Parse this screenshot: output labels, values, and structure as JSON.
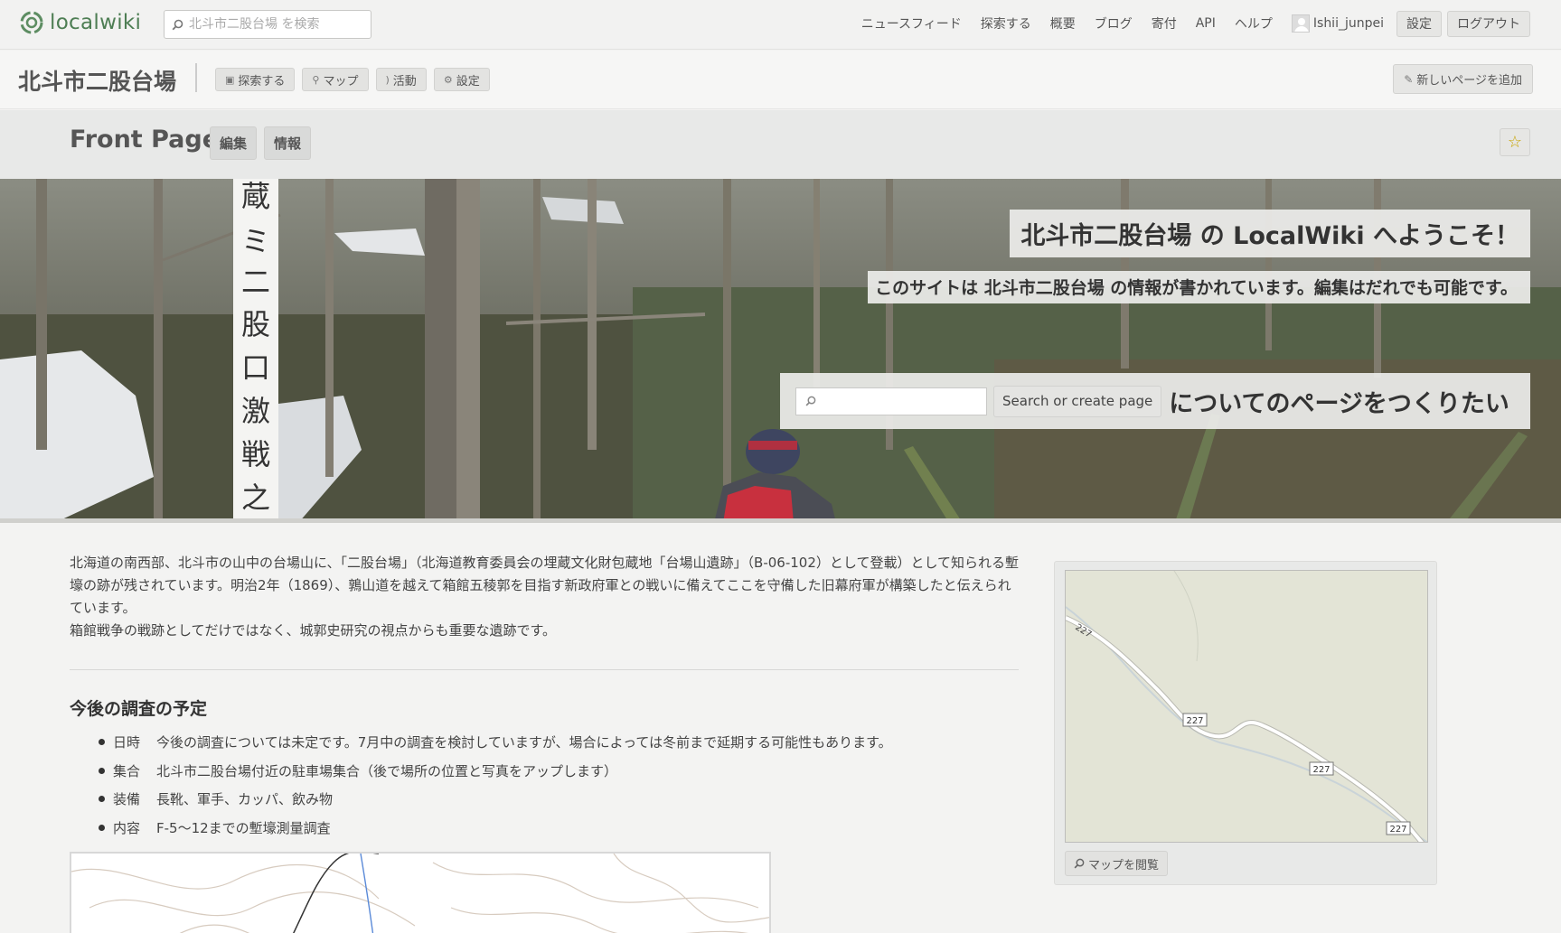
{
  "brand": {
    "name": "localwiki"
  },
  "top_search": {
    "placeholder": "北斗市二股台場 を検索"
  },
  "topnav": {
    "links": [
      "ニュースフィード",
      "探索する",
      "概要",
      "ブログ",
      "寄付",
      "API",
      "ヘルプ"
    ],
    "username": "Ishii_junpei",
    "settings_label": "設定",
    "logout_label": "ログアウト"
  },
  "region": {
    "title": "北斗市二股台場",
    "explore_label": "探索する",
    "map_label": "マップ",
    "activity_label": "活動",
    "settings_label": "設定",
    "new_page_label": "新しいページを追加"
  },
  "page": {
    "title": "Front Page",
    "edit_tab": "編集",
    "info_tab": "情報"
  },
  "hero": {
    "welcome": "北斗市二股台場 の LocalWiki へようこそ！",
    "subtitle": "このサイトは 北斗市二股台場 の情報が書かれています。編集はだれでも可能です。",
    "create_button": "Search or create page",
    "create_suffix": "についてのページをつくりたい",
    "signpost_text": "蔵ミ二股口激戦之地"
  },
  "intro": {
    "paragraph1": "北海道の南西部、北斗市の山中の台場山に、「二股台場」（北海道教育委員会の埋蔵文化財包蔵地「台場山遺跡」（B-06-102）として登載）として知られる塹壕の跡が残されています。明治2年（1869）、鶉山道を越えて箱館五稜郭を目指す新政府軍との戦いに備えてここを守備した旧幕府軍が構築したと伝えられています。",
    "paragraph2": "箱館戦争の戦跡としてだけではなく、城郭史研究の視点からも重要な遺跡です。"
  },
  "schedule": {
    "heading": "今後の調査の予定",
    "items": [
      {
        "term": "日時",
        "text": "今後の調査については未定です。7月中の調査を検討していますが、場合によっては冬前まで延期する可能性もあります。"
      },
      {
        "term": "集合",
        "text": "北斗市二股台場付近の駐車場集合（後で場所の位置と写真をアップします）"
      },
      {
        "term": "装備",
        "text": "長靴、軍手、カッパ、飲み物"
      },
      {
        "term": "内容",
        "text": "F-5〜12までの塹壕測量調査"
      }
    ]
  },
  "map": {
    "route_labels": [
      "227",
      "227",
      "227",
      "227"
    ],
    "view_map_label": "マップを閲覧"
  },
  "colors": {
    "brand_green": "#4e7e54",
    "star_yellow": "#c8a400"
  }
}
